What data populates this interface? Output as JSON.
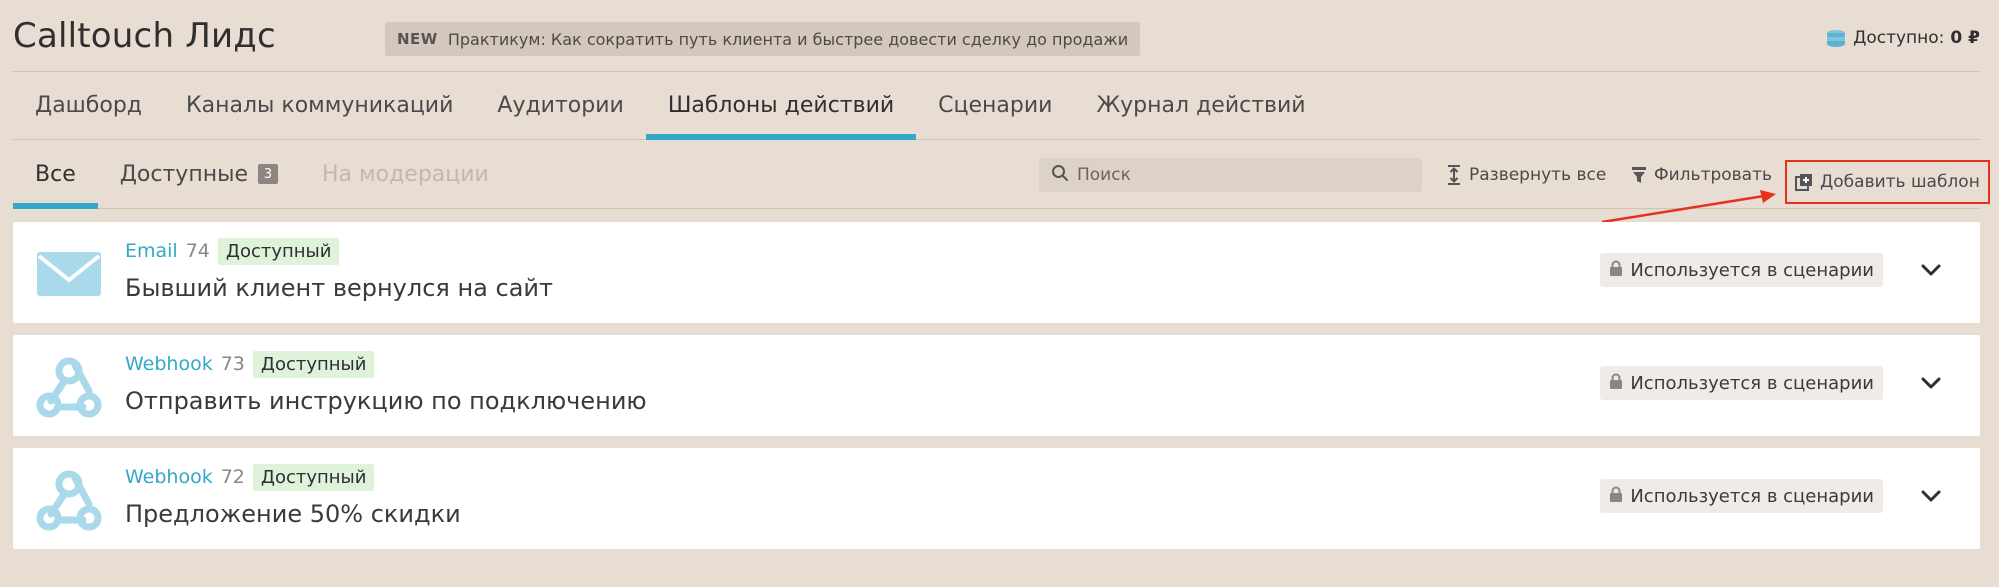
{
  "header": {
    "app_title": "Calltouch Лидс",
    "promo_badge": "NEW",
    "promo_text": "Практикум: Как сократить путь клиента и быстрее довести сделку до продажи",
    "balance_label": "Доступно:",
    "balance_value": "0 ₽",
    "balance_icon": "coins-icon"
  },
  "main_nav": {
    "tabs": [
      {
        "label": "Дашборд"
      },
      {
        "label": "Каналы коммуникаций"
      },
      {
        "label": "Аудитории"
      },
      {
        "label": "Шаблоны действий"
      },
      {
        "label": "Сценарии"
      },
      {
        "label": "Журнал действий"
      }
    ],
    "active_index": 3
  },
  "sub_nav": {
    "tabs": [
      {
        "label": "Все"
      },
      {
        "label": "Доступные",
        "count": "3"
      },
      {
        "label": "На модерации"
      }
    ],
    "active_index": 0
  },
  "toolbar": {
    "search_placeholder": "Поиск",
    "expand_label": "Развернуть все",
    "filter_label": "Фильтровать",
    "add_label": "Добавить шаблон"
  },
  "templates": [
    {
      "type": "Email",
      "id": "74",
      "status": "Доступный",
      "title": "Бывший клиент вернулся на сайт",
      "usage": "Используется в сценарии",
      "icon": "email-icon"
    },
    {
      "type": "Webhook",
      "id": "73",
      "status": "Доступный",
      "title": "Отправить инструкцию по подключению",
      "usage": "Используется в сценарии",
      "icon": "webhook-icon"
    },
    {
      "type": "Webhook",
      "id": "72",
      "status": "Доступный",
      "title": "Предложение 50% скидки",
      "usage": "Используется в сценарии",
      "icon": "webhook-icon"
    }
  ],
  "colors": {
    "background": "#e8ddd3",
    "accent": "#33a8c9",
    "status_bg": "#dff2da",
    "annotation": "#e8301e"
  }
}
